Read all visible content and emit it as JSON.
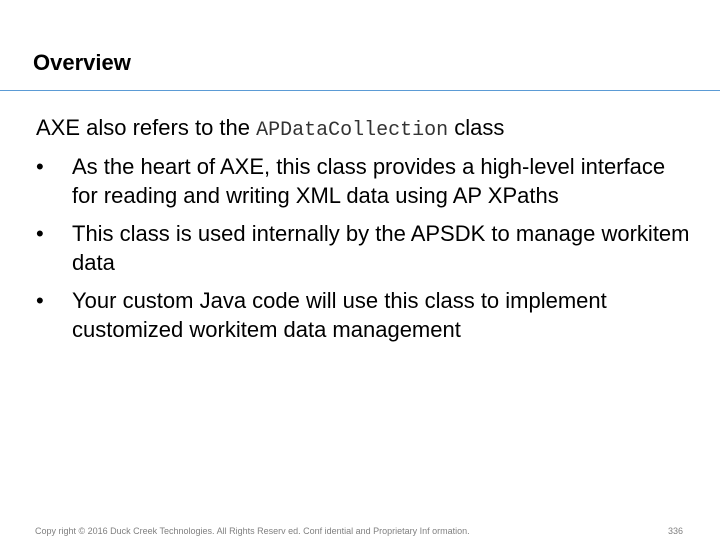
{
  "slide": {
    "title": "Overview",
    "intro": {
      "prefix": "AXE also refers to the",
      "code": "APDataCollection",
      "suffix": "class"
    },
    "bullet_symbol": "•",
    "bullets": [
      {
        "text": "As the heart of AXE, this class provides a high-level interface for reading and writing XML data using AP XPaths"
      },
      {
        "text": "This class is used internally by the APSDK to manage workitem data"
      },
      {
        "text": "Your custom Java code will use this class to implement customized workitem data management"
      }
    ],
    "footer": "Copy right © 2016 Duck Creek Technologies. All Rights Reserv ed. Conf idential and Proprietary Inf ormation.",
    "page_number": "336",
    "colors": {
      "divider": "#5b9bd5",
      "footer_text": "#808080"
    }
  }
}
